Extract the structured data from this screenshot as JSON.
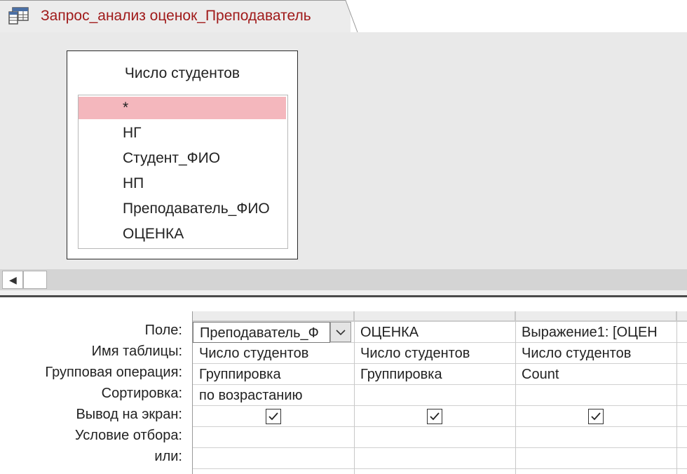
{
  "tab": {
    "title": "Запрос_анализ оценок_Преподаватель",
    "icon": "query-table-icon"
  },
  "table_box": {
    "title": "Число студентов",
    "fields": [
      "*",
      "НГ",
      "Студент_ФИО",
      "НП",
      "Преподаватель_ФИО",
      "ОЦЕНКА"
    ],
    "selected_index": 0
  },
  "grid": {
    "row_labels": [
      "Поле:",
      "Имя таблицы:",
      "Групповая операция:",
      "Сортировка:",
      "Вывод на экран:",
      "Условие отбора:",
      "или:"
    ],
    "columns": [
      {
        "field": "Преподаватель_Ф",
        "table": "Число студентов",
        "group": "Группировка",
        "sort": "по возрастанию",
        "show": true
      },
      {
        "field": "ОЦЕНКА",
        "table": "Число студентов",
        "group": "Группировка",
        "sort": "",
        "show": true
      },
      {
        "field": "Выражение1: [ОЦЕН",
        "table": "Число студентов",
        "group": "Count",
        "sort": "",
        "show": true
      }
    ]
  },
  "colors": {
    "title": "#a01a1a",
    "selected_field": "#f4b7bd",
    "design_bg": "#e9e9e9"
  }
}
